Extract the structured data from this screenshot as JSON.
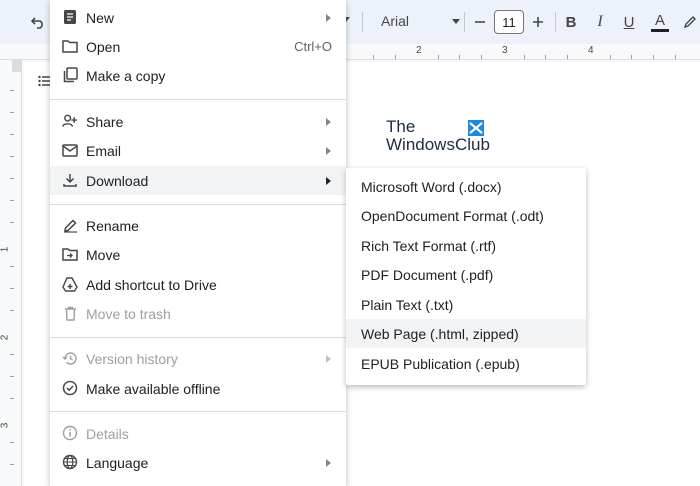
{
  "toolbar": {
    "font_name": "Arial",
    "font_size": "11",
    "bold_label": "B",
    "italic_label": "I",
    "underline_label": "U",
    "text_color_label": "A"
  },
  "ruler": {
    "top_numbers": [
      "2",
      "3",
      "4"
    ],
    "left_numbers": [
      "1",
      "2",
      "3"
    ]
  },
  "logo": {
    "line1": "The",
    "line2": "WindowsClub"
  },
  "file_menu": {
    "new": "New",
    "open": "Open",
    "open_shortcut": "Ctrl+O",
    "make_copy": "Make a copy",
    "share": "Share",
    "email": "Email",
    "download": "Download",
    "rename": "Rename",
    "move": "Move",
    "add_shortcut": "Add shortcut to Drive",
    "move_trash": "Move to trash",
    "version_history": "Version history",
    "offline": "Make available offline",
    "details": "Details",
    "language": "Language"
  },
  "download_menu": [
    "Microsoft Word (.docx)",
    "OpenDocument Format (.odt)",
    "Rich Text Format (.rtf)",
    "PDF Document (.pdf)",
    "Plain Text (.txt)",
    "Web Page (.html, zipped)",
    "EPUB Publication (.epub)"
  ],
  "colors": {
    "toolbar_bg": "#edf2fa",
    "menu_highlight": "#f1f3f4",
    "disabled_text": "#9aa0a6"
  }
}
